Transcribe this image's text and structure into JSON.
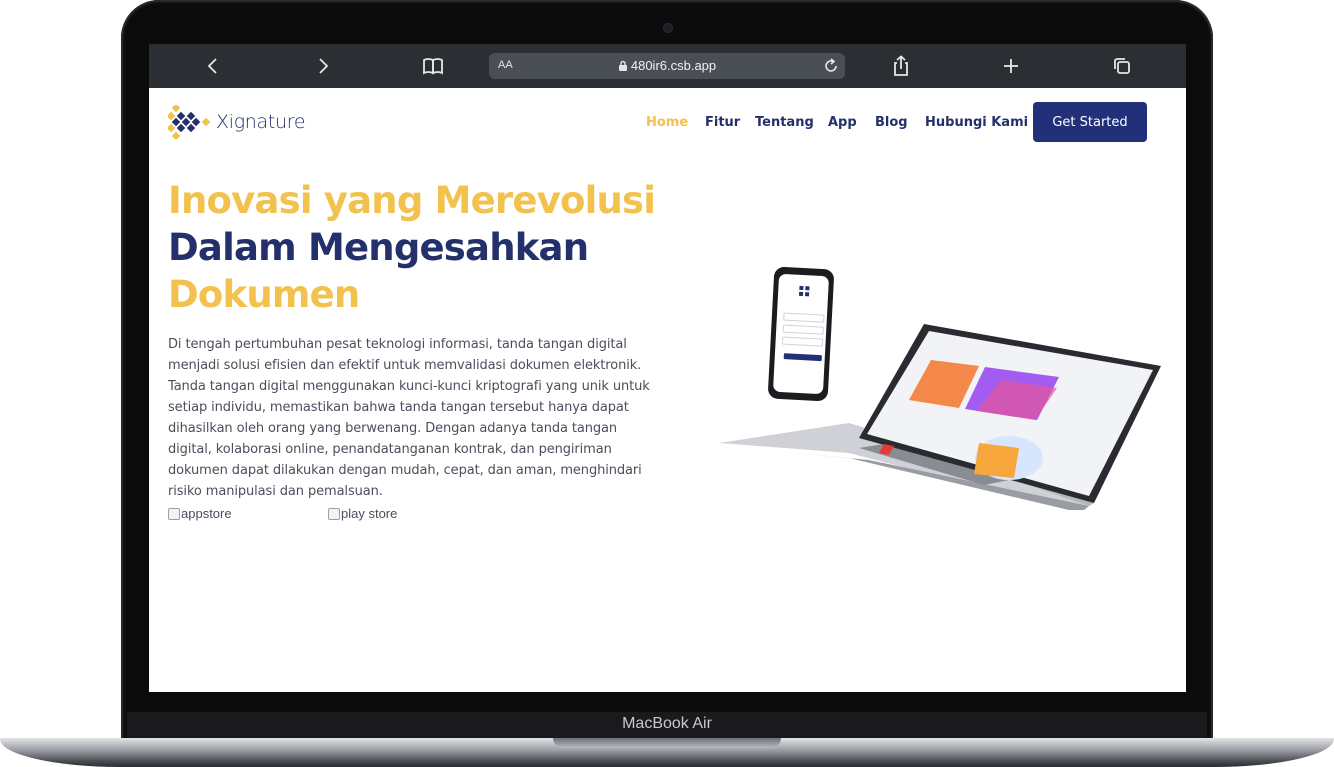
{
  "device": {
    "label": "MacBook Air"
  },
  "browser": {
    "text_size_label": "AA",
    "url": "480ir6.csb.app",
    "icons": [
      "chevron-left-icon",
      "chevron-right-icon",
      "book-icon",
      "lock-icon",
      "reload-icon",
      "share-icon",
      "plus-icon",
      "tabs-icon"
    ]
  },
  "site": {
    "brand": "Xignature",
    "nav": [
      {
        "label": "Home",
        "active": true
      },
      {
        "label": "Fitur",
        "active": false
      },
      {
        "label": "Tentang",
        "active": false
      },
      {
        "label": "App",
        "active": false
      },
      {
        "label": "Blog",
        "active": false
      },
      {
        "label": "Hubungi Kami",
        "active": false
      }
    ],
    "cta": "Get Started",
    "colors": {
      "accent": "#f2c14e",
      "brand": "#24306b",
      "button": "#22307a"
    }
  },
  "hero": {
    "line1": "Inovasi yang Merevolusi",
    "line2": "Dalam Mengesahkan",
    "line3": "Dokumen",
    "description": "Di tengah pertumbuhan pesat teknologi informasi, tanda tangan digital menjadi solusi efisien dan efektif untuk memvalidasi dokumen elektronik. Tanda tangan digital menggunakan kunci-kunci kriptografi yang unik untuk setiap individu, memastikan bahwa tanda tangan tersebut hanya dapat dihasilkan oleh orang yang berwenang. Dengan adanya tanda tangan digital, kolaborasi online, penandatanganan kontrak, dan pengiriman dokumen dapat dilakukan dengan mudah, cepat, dan aman, menghindari risiko manipulasi dan pemalsuan.",
    "appstore_alt": "appstore",
    "playstore_alt": "play store"
  }
}
